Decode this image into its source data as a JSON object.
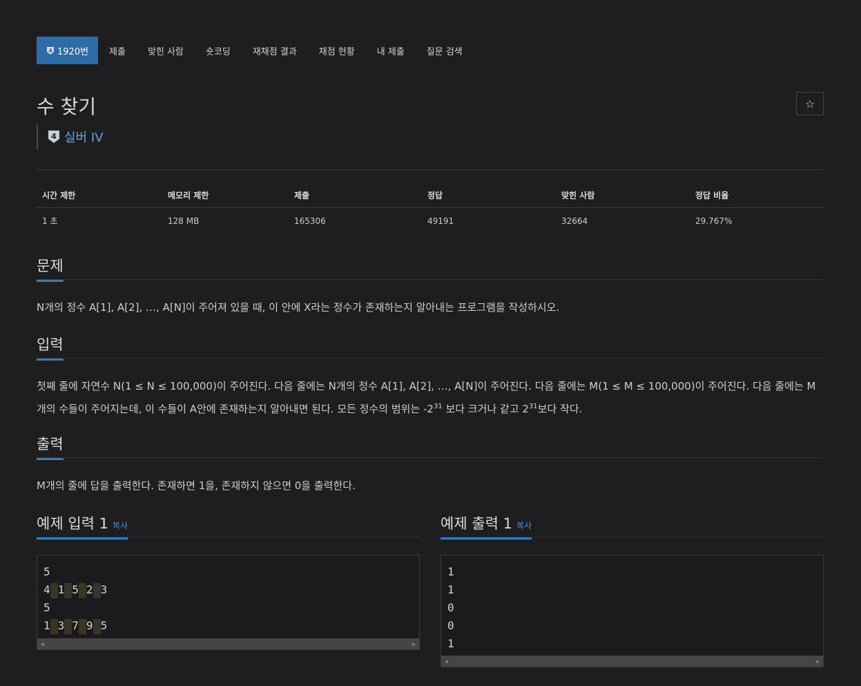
{
  "tabs": [
    {
      "label": "1920번",
      "active": true
    },
    {
      "label": "제출"
    },
    {
      "label": "맞힌 사람"
    },
    {
      "label": "숏코딩"
    },
    {
      "label": "재채점 결과"
    },
    {
      "label": "채점 현황"
    },
    {
      "label": "내 제출"
    },
    {
      "label": "질문 검색"
    }
  ],
  "problem": {
    "title": "수 찾기",
    "tier": "실버 IV",
    "tier_number": "4",
    "star": "☆"
  },
  "info": {
    "headers": [
      "시간 제한",
      "메모리 제한",
      "제출",
      "정답",
      "맞힌 사람",
      "정답 비율"
    ],
    "values": [
      "1 초",
      "128 MB",
      "165306",
      "49191",
      "32664",
      "29.767%"
    ]
  },
  "sections": {
    "problem": {
      "heading": "문제",
      "text": "N개의 정수 A[1], A[2], …, A[N]이 주어져 있을 때, 이 안에 X라는 정수가 존재하는지 알아내는 프로그램을 작성하시오."
    },
    "input": {
      "heading": "입력",
      "line1": "첫째 줄에 자연수 N(1 ≤ N ≤ 100,000)이 주어진다. 다음 줄에는 N개의 정수 A[1], A[2], …, A[N]이 주어진다. 다음 줄에는 M(1 ≤ M ≤ 100,000)이 주어진다. 다음 줄에는 M",
      "line2_a": "개의 수들이 주어지는데, 이 수들이 A안에 존재하는지 알아내면 된다. 모든 정수의 범위는 -2",
      "sup1": "31",
      "line2_b": " 보다 크거나 같고 2",
      "sup2": "31",
      "line2_c": "보다 작다."
    },
    "output": {
      "heading": "출력",
      "text": "M개의 줄에 답을 출력한다. 존재하면 1을, 존재하지 않으면 0을 출력한다."
    }
  },
  "samples": {
    "input": {
      "heading": "예제 입력 1",
      "copy": "복사",
      "lines": [
        [
          "5"
        ],
        [
          "4",
          "1",
          "5",
          "2",
          "3"
        ],
        [
          "5"
        ],
        [
          "1",
          "3",
          "7",
          "9",
          "5"
        ]
      ]
    },
    "output": {
      "heading": "예제 출력 1",
      "copy": "복사",
      "lines": [
        [
          "1"
        ],
        [
          "1"
        ],
        [
          "0"
        ],
        [
          "0"
        ],
        [
          "1"
        ]
      ]
    }
  }
}
